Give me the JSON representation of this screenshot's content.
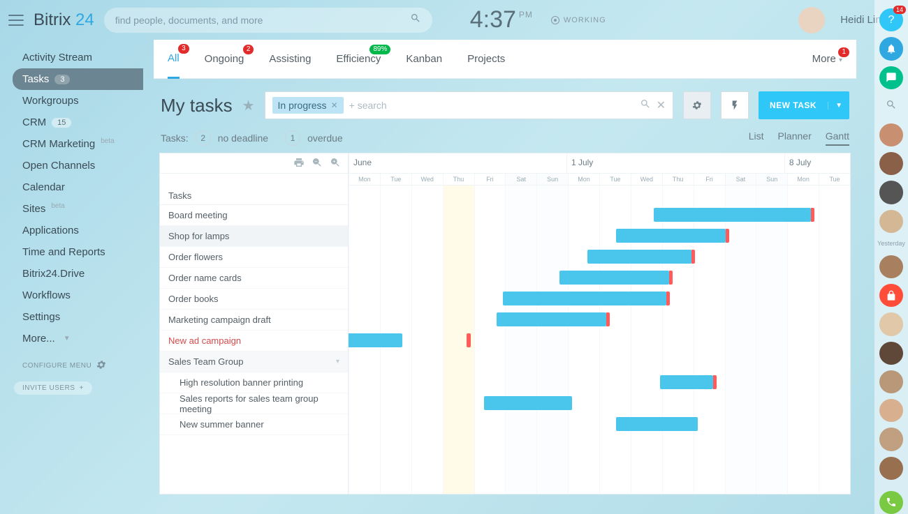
{
  "header": {
    "logo_brand": "Bitrix",
    "logo_num": "24",
    "search_placeholder": "find people, documents, and more",
    "clock_time": "4:37",
    "clock_ampm": "PM",
    "working_label": "WORKING",
    "username": "Heidi Ling"
  },
  "sidebar": {
    "items": [
      {
        "label": "Activity Stream"
      },
      {
        "label": "Tasks",
        "count": "3",
        "active": true
      },
      {
        "label": "Workgroups"
      },
      {
        "label": "CRM",
        "count": "15"
      },
      {
        "label": "CRM Marketing",
        "beta": true
      },
      {
        "label": "Open Channels"
      },
      {
        "label": "Calendar"
      },
      {
        "label": "Sites",
        "beta": true
      },
      {
        "label": "Applications"
      },
      {
        "label": "Time and Reports"
      },
      {
        "label": "Bitrix24.Drive"
      },
      {
        "label": "Workflows"
      },
      {
        "label": "Settings"
      },
      {
        "label": "More...",
        "caret": true
      }
    ],
    "configure": "CONFIGURE MENU",
    "invite": "INVITE USERS"
  },
  "tabs": {
    "items": [
      {
        "label": "All",
        "badge": "3",
        "active": true
      },
      {
        "label": "Ongoing",
        "badge": "2"
      },
      {
        "label": "Assisting"
      },
      {
        "label": "Efficiency",
        "badge": "89%",
        "green": true
      },
      {
        "label": "Kanban"
      },
      {
        "label": "Projects"
      }
    ],
    "more": "More",
    "more_badge": "1"
  },
  "title": {
    "text": "My tasks"
  },
  "filter": {
    "chip": "In progress",
    "placeholder": "+ search"
  },
  "new_task": "NEW TASK",
  "subbar": {
    "tasks_label": "Tasks:",
    "no_deadline_count": "2",
    "no_deadline_label": "no deadline",
    "overdue_count": "1",
    "overdue_label": "overdue",
    "views": [
      "List",
      "Planner",
      "Gantt"
    ],
    "active_view": "Gantt"
  },
  "gantt": {
    "header": "Tasks",
    "months": [
      "June",
      "1 July",
      "8 July"
    ],
    "days": [
      "Mon",
      "Tue",
      "Wed",
      "Thu",
      "Fri",
      "Sat",
      "Sun",
      "Mon",
      "Tue",
      "Wed",
      "Thu",
      "Fri",
      "Sat",
      "Sun",
      "Mon",
      "Tue"
    ],
    "today_index": 3,
    "weekend_indexes": [
      5,
      6,
      12,
      13
    ],
    "rows": [
      {
        "label": "Board meeting"
      },
      {
        "label": "Shop for lamps",
        "sel": true
      },
      {
        "label": "Order flowers"
      },
      {
        "label": "Order name cards"
      },
      {
        "label": "Order books"
      },
      {
        "label": "Marketing campaign draft"
      },
      {
        "label": "New ad campaign",
        "red": true
      },
      {
        "label": "Sales Team Group",
        "group": true
      },
      {
        "label": "High resolution banner printing",
        "sub": true
      },
      {
        "label": "Sales reports for sales team group meeting",
        "sub": true
      },
      {
        "label": "New summer banner",
        "sub": true
      }
    ],
    "bars": [
      {
        "row": 0,
        "start": 9.7,
        "end": 14.7,
        "endcap": true
      },
      {
        "row": 1,
        "start": 8.5,
        "end": 12,
        "endcap": true
      },
      {
        "row": 2,
        "start": 7.6,
        "end": 10.9,
        "endcap": true
      },
      {
        "row": 3,
        "start": 6.7,
        "end": 10.2,
        "endcap": true
      },
      {
        "row": 4,
        "start": 4.9,
        "end": 10.1,
        "endcap": true
      },
      {
        "row": 5,
        "start": 4.7,
        "end": 8.2,
        "endcap": true
      },
      {
        "row": 6,
        "start": -0.3,
        "end": 1.7,
        "endcap": false
      },
      {
        "row": 6,
        "start": 3.75,
        "end": 3.85,
        "endcap": true,
        "thin": true
      },
      {
        "row": 8,
        "start": 9.9,
        "end": 11.6,
        "endcap": true
      },
      {
        "row": 9,
        "start": 4.3,
        "end": 7.1,
        "endcap": false
      },
      {
        "row": 10,
        "start": 8.5,
        "end": 11.1,
        "endcap": false
      }
    ]
  },
  "rail": {
    "help_badge": "14",
    "yesterday": "Yesterday"
  }
}
